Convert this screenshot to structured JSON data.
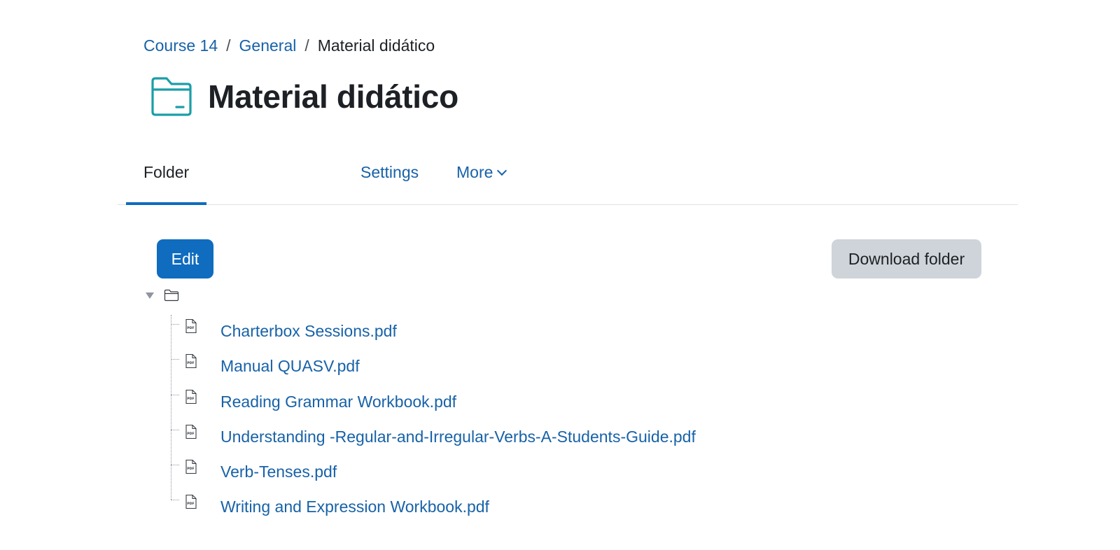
{
  "breadcrumb": {
    "items": [
      {
        "label": "Course 14"
      },
      {
        "label": "General"
      }
    ],
    "separator": "/",
    "current": "Material didático"
  },
  "header": {
    "title": "Material didático",
    "icon": "folder-icon",
    "icon_color": "#1a9ea8"
  },
  "tabs": [
    {
      "label": "Folder",
      "active": true
    },
    {
      "label": "Settings",
      "active": false
    },
    {
      "label": "More",
      "active": false,
      "dropdown": true
    }
  ],
  "actions": {
    "edit_label": "Edit",
    "download_label": "Download folder"
  },
  "tree": {
    "root_expanded": true,
    "files": [
      {
        "name": "Charterbox Sessions.pdf",
        "icon": "pdf-icon"
      },
      {
        "name": "Manual QUASV.pdf",
        "icon": "pdf-icon"
      },
      {
        "name": "Reading Grammar Workbook.pdf",
        "icon": "pdf-icon"
      },
      {
        "name": "Understanding -Regular-and-Irregular-Verbs-A-Students-Guide.pdf",
        "icon": "pdf-icon"
      },
      {
        "name": "Verb-Tenses.pdf",
        "icon": "pdf-icon"
      },
      {
        "name": "Writing and Expression Workbook.pdf",
        "icon": "pdf-icon"
      }
    ]
  },
  "colors": {
    "link": "#1762a8",
    "primary": "#0f6cbf",
    "secondary_button": "#ced4da",
    "text": "#1d2125"
  }
}
